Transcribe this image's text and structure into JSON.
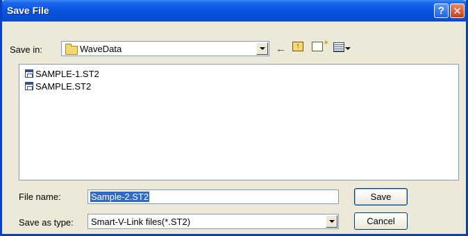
{
  "window": {
    "title": "Save File",
    "help_label": "?",
    "close_label": "✕"
  },
  "location": {
    "label": "Save in:",
    "value": "WaveData",
    "folder_icon": "folder-icon"
  },
  "toolbar": {
    "back_icon": "back-arrow-icon",
    "up_icon": "up-folder-icon",
    "new_folder_icon": "new-folder-icon",
    "views_icon": "views-menu-icon"
  },
  "files": [
    {
      "name": "SAMPLE-1.ST2"
    },
    {
      "name": "SAMPLE.ST2"
    }
  ],
  "filename": {
    "label": "File name:",
    "value": "Sample-2.ST2"
  },
  "filetype": {
    "label": "Save as type:",
    "value": "Smart-V-Link files(*.ST2)"
  },
  "buttons": {
    "save": "Save",
    "cancel": "Cancel"
  }
}
